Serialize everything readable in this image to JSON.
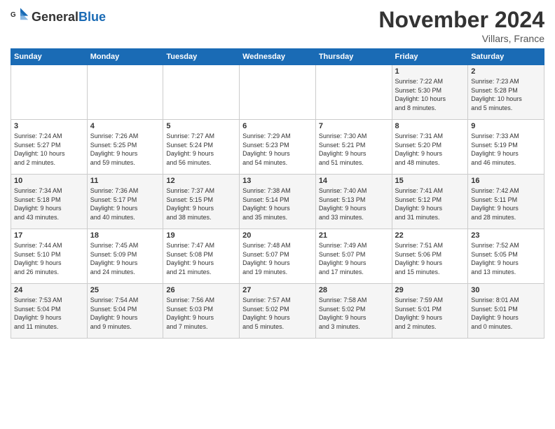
{
  "header": {
    "logo_general": "General",
    "logo_blue": "Blue",
    "month_title": "November 2024",
    "location": "Villars, France"
  },
  "weekdays": [
    "Sunday",
    "Monday",
    "Tuesday",
    "Wednesday",
    "Thursday",
    "Friday",
    "Saturday"
  ],
  "weeks": [
    [
      {
        "day": "",
        "info": ""
      },
      {
        "day": "",
        "info": ""
      },
      {
        "day": "",
        "info": ""
      },
      {
        "day": "",
        "info": ""
      },
      {
        "day": "",
        "info": ""
      },
      {
        "day": "1",
        "info": "Sunrise: 7:22 AM\nSunset: 5:30 PM\nDaylight: 10 hours\nand 8 minutes."
      },
      {
        "day": "2",
        "info": "Sunrise: 7:23 AM\nSunset: 5:28 PM\nDaylight: 10 hours\nand 5 minutes."
      }
    ],
    [
      {
        "day": "3",
        "info": "Sunrise: 7:24 AM\nSunset: 5:27 PM\nDaylight: 10 hours\nand 2 minutes."
      },
      {
        "day": "4",
        "info": "Sunrise: 7:26 AM\nSunset: 5:25 PM\nDaylight: 9 hours\nand 59 minutes."
      },
      {
        "day": "5",
        "info": "Sunrise: 7:27 AM\nSunset: 5:24 PM\nDaylight: 9 hours\nand 56 minutes."
      },
      {
        "day": "6",
        "info": "Sunrise: 7:29 AM\nSunset: 5:23 PM\nDaylight: 9 hours\nand 54 minutes."
      },
      {
        "day": "7",
        "info": "Sunrise: 7:30 AM\nSunset: 5:21 PM\nDaylight: 9 hours\nand 51 minutes."
      },
      {
        "day": "8",
        "info": "Sunrise: 7:31 AM\nSunset: 5:20 PM\nDaylight: 9 hours\nand 48 minutes."
      },
      {
        "day": "9",
        "info": "Sunrise: 7:33 AM\nSunset: 5:19 PM\nDaylight: 9 hours\nand 46 minutes."
      }
    ],
    [
      {
        "day": "10",
        "info": "Sunrise: 7:34 AM\nSunset: 5:18 PM\nDaylight: 9 hours\nand 43 minutes."
      },
      {
        "day": "11",
        "info": "Sunrise: 7:36 AM\nSunset: 5:17 PM\nDaylight: 9 hours\nand 40 minutes."
      },
      {
        "day": "12",
        "info": "Sunrise: 7:37 AM\nSunset: 5:15 PM\nDaylight: 9 hours\nand 38 minutes."
      },
      {
        "day": "13",
        "info": "Sunrise: 7:38 AM\nSunset: 5:14 PM\nDaylight: 9 hours\nand 35 minutes."
      },
      {
        "day": "14",
        "info": "Sunrise: 7:40 AM\nSunset: 5:13 PM\nDaylight: 9 hours\nand 33 minutes."
      },
      {
        "day": "15",
        "info": "Sunrise: 7:41 AM\nSunset: 5:12 PM\nDaylight: 9 hours\nand 31 minutes."
      },
      {
        "day": "16",
        "info": "Sunrise: 7:42 AM\nSunset: 5:11 PM\nDaylight: 9 hours\nand 28 minutes."
      }
    ],
    [
      {
        "day": "17",
        "info": "Sunrise: 7:44 AM\nSunset: 5:10 PM\nDaylight: 9 hours\nand 26 minutes."
      },
      {
        "day": "18",
        "info": "Sunrise: 7:45 AM\nSunset: 5:09 PM\nDaylight: 9 hours\nand 24 minutes."
      },
      {
        "day": "19",
        "info": "Sunrise: 7:47 AM\nSunset: 5:08 PM\nDaylight: 9 hours\nand 21 minutes."
      },
      {
        "day": "20",
        "info": "Sunrise: 7:48 AM\nSunset: 5:07 PM\nDaylight: 9 hours\nand 19 minutes."
      },
      {
        "day": "21",
        "info": "Sunrise: 7:49 AM\nSunset: 5:07 PM\nDaylight: 9 hours\nand 17 minutes."
      },
      {
        "day": "22",
        "info": "Sunrise: 7:51 AM\nSunset: 5:06 PM\nDaylight: 9 hours\nand 15 minutes."
      },
      {
        "day": "23",
        "info": "Sunrise: 7:52 AM\nSunset: 5:05 PM\nDaylight: 9 hours\nand 13 minutes."
      }
    ],
    [
      {
        "day": "24",
        "info": "Sunrise: 7:53 AM\nSunset: 5:04 PM\nDaylight: 9 hours\nand 11 minutes."
      },
      {
        "day": "25",
        "info": "Sunrise: 7:54 AM\nSunset: 5:04 PM\nDaylight: 9 hours\nand 9 minutes."
      },
      {
        "day": "26",
        "info": "Sunrise: 7:56 AM\nSunset: 5:03 PM\nDaylight: 9 hours\nand 7 minutes."
      },
      {
        "day": "27",
        "info": "Sunrise: 7:57 AM\nSunset: 5:02 PM\nDaylight: 9 hours\nand 5 minutes."
      },
      {
        "day": "28",
        "info": "Sunrise: 7:58 AM\nSunset: 5:02 PM\nDaylight: 9 hours\nand 3 minutes."
      },
      {
        "day": "29",
        "info": "Sunrise: 7:59 AM\nSunset: 5:01 PM\nDaylight: 9 hours\nand 2 minutes."
      },
      {
        "day": "30",
        "info": "Sunrise: 8:01 AM\nSunset: 5:01 PM\nDaylight: 9 hours\nand 0 minutes."
      }
    ]
  ]
}
